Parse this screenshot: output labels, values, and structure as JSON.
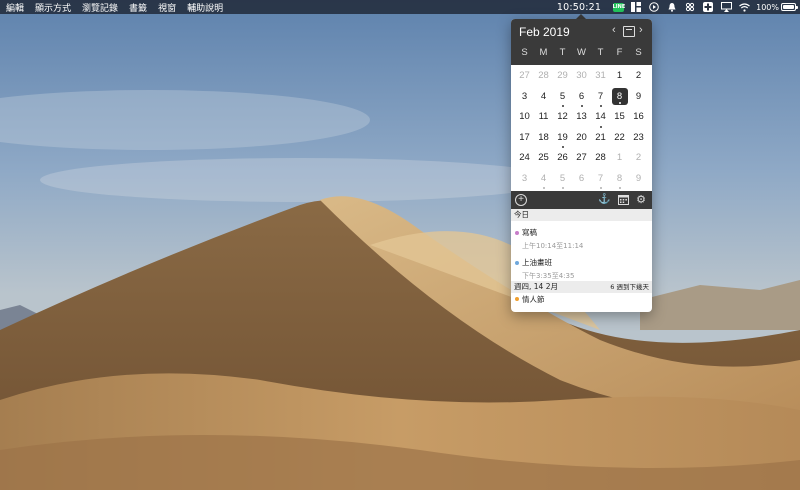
{
  "menubar": {
    "items": [
      "編輯",
      "顯示方式",
      "瀏覽記錄",
      "書籤",
      "視窗",
      "輔助說明"
    ],
    "clock": "10:50:21",
    "battery_percent": "100%",
    "line_badge": "LINE",
    "tray_icons": [
      "line-icon",
      "grid-icon",
      "play-icon",
      "bell-icon",
      "cube-icon",
      "plus-cross-icon",
      "airplay-icon",
      "wifi-icon",
      "battery-icon"
    ]
  },
  "calendar": {
    "month_title": "Feb 2019",
    "weekdays": [
      "S",
      "M",
      "T",
      "W",
      "T",
      "F",
      "S"
    ],
    "weeks": [
      [
        {
          "d": "27",
          "m": true
        },
        {
          "d": "28",
          "m": true
        },
        {
          "d": "29",
          "m": true
        },
        {
          "d": "30",
          "m": true
        },
        {
          "d": "31",
          "m": true
        },
        {
          "d": "1"
        },
        {
          "d": "2"
        }
      ],
      [
        {
          "d": "3"
        },
        {
          "d": "4"
        },
        {
          "d": "5",
          "dot": true
        },
        {
          "d": "6",
          "dot": true
        },
        {
          "d": "7",
          "dot": true
        },
        {
          "d": "8",
          "sel": true,
          "dot": true
        },
        {
          "d": "9"
        }
      ],
      [
        {
          "d": "10"
        },
        {
          "d": "11"
        },
        {
          "d": "12"
        },
        {
          "d": "13"
        },
        {
          "d": "14",
          "dot": true
        },
        {
          "d": "15"
        },
        {
          "d": "16"
        }
      ],
      [
        {
          "d": "17"
        },
        {
          "d": "18"
        },
        {
          "d": "19",
          "dot": true
        },
        {
          "d": "20"
        },
        {
          "d": "21"
        },
        {
          "d": "22"
        },
        {
          "d": "23"
        }
      ],
      [
        {
          "d": "24"
        },
        {
          "d": "25"
        },
        {
          "d": "26"
        },
        {
          "d": "27"
        },
        {
          "d": "28"
        },
        {
          "d": "1",
          "m": true
        },
        {
          "d": "2",
          "m": true
        }
      ],
      [
        {
          "d": "3",
          "m": true
        },
        {
          "d": "4",
          "m": true,
          "dot": true
        },
        {
          "d": "5",
          "m": true,
          "dot": true
        },
        {
          "d": "6",
          "m": true
        },
        {
          "d": "7",
          "m": true,
          "dot": true
        },
        {
          "d": "8",
          "m": true,
          "dot": true
        },
        {
          "d": "9",
          "m": true
        }
      ]
    ],
    "accent": "#3a3a3a"
  },
  "events": {
    "today_label": "今日",
    "today_items": [
      {
        "title": "寫稿",
        "time": "上午10:14至11:14",
        "color": "#c77dc9"
      },
      {
        "title": "上油畫班",
        "time": "下午3:35至4:35",
        "color": "#6fa8dc"
      }
    ],
    "next_label": "週四, 14 2月",
    "next_note": "6 週到下幾天",
    "next_items": [
      {
        "title": "情人節",
        "color": "#f0a030"
      }
    ]
  }
}
